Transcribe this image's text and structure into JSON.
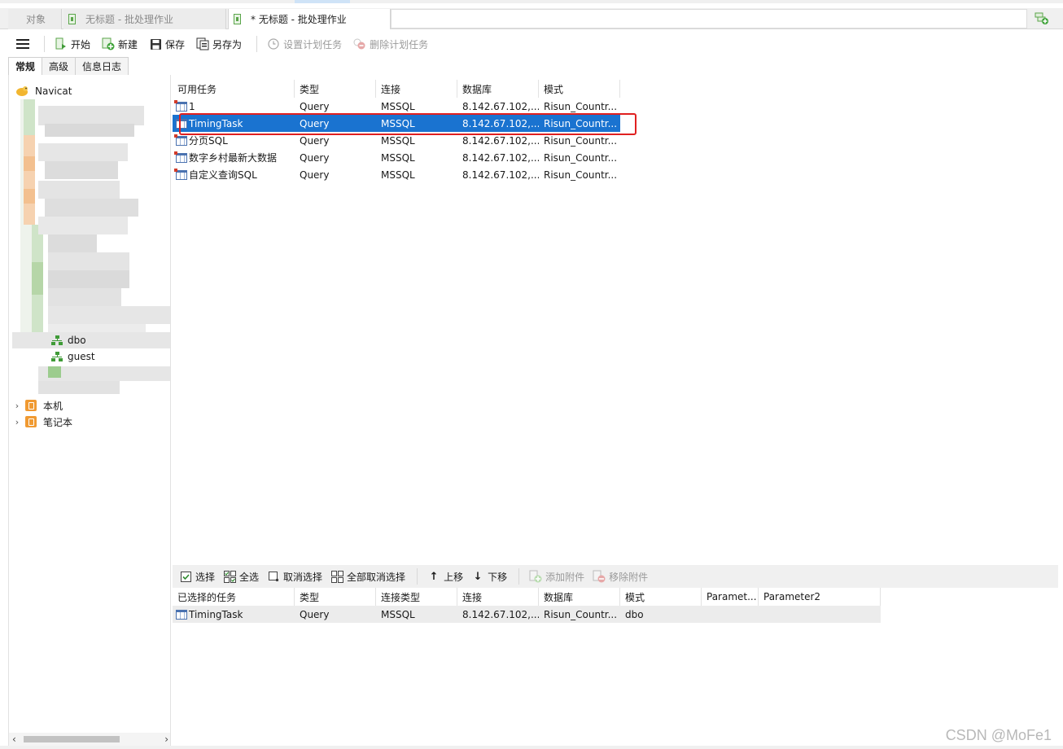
{
  "tabs": [
    {
      "label": "对象",
      "active": false
    },
    {
      "label": "无标题 - 批处理作业",
      "active": false
    },
    {
      "label": "* 无标题 - 批处理作业",
      "active": true
    }
  ],
  "toolbar": {
    "start": "开始",
    "new": "新建",
    "save": "保存",
    "save_as": "另存为",
    "set_schedule": "设置计划任务",
    "delete_schedule": "删除计划任务"
  },
  "subtabs": [
    "常规",
    "高级",
    "信息日志"
  ],
  "tree": {
    "root": "Navicat",
    "schemas": [
      "dbo",
      "guest"
    ],
    "connections": [
      "本机",
      "笔记本"
    ]
  },
  "available": {
    "columns": [
      "可用任务",
      "类型",
      "连接",
      "数据库",
      "模式"
    ],
    "rows": [
      {
        "name": "1",
        "type": "Query",
        "conn": "MSSQL",
        "db": "8.142.67.102,...",
        "schema": "Risun_Countr..."
      },
      {
        "name": "TimingTask",
        "type": "Query",
        "conn": "MSSQL",
        "db": "8.142.67.102,...",
        "schema": "Risun_Countr..."
      },
      {
        "name": "分页SQL",
        "type": "Query",
        "conn": "MSSQL",
        "db": "8.142.67.102,...",
        "schema": "Risun_Countr..."
      },
      {
        "name": "数字乡村最新大数据",
        "type": "Query",
        "conn": "MSSQL",
        "db": "8.142.67.102,...",
        "schema": "Risun_Countr..."
      },
      {
        "name": "自定义查询SQL",
        "type": "Query",
        "conn": "MSSQL",
        "db": "8.142.67.102,...",
        "schema": "Risun_Countr..."
      }
    ],
    "selected_index": 1
  },
  "bottom_toolbar": {
    "select": "选择",
    "select_all": "全选",
    "deselect": "取消选择",
    "deselect_all": "全部取消选择",
    "move_up": "上移",
    "move_down": "下移",
    "add_attachment": "添加附件",
    "remove_attachment": "移除附件"
  },
  "selected": {
    "columns": [
      "已选择的任务",
      "类型",
      "连接类型",
      "连接",
      "数据库",
      "模式",
      "Paramet...",
      "Parameter2"
    ],
    "rows": [
      {
        "name": "TimingTask",
        "type": "Query",
        "conn_type": "MSSQL",
        "conn": "8.142.67.102,...",
        "db": "Risun_Countr...",
        "schema": "dbo",
        "p1": "",
        "p2": ""
      }
    ]
  },
  "watermark": "CSDN @MoFe1"
}
